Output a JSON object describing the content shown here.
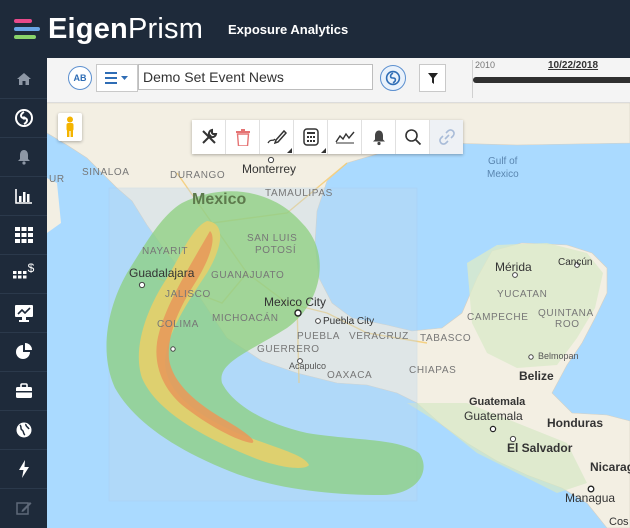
{
  "header": {
    "brand_part1": "Eigen",
    "brand_part2": "Prism",
    "app_title": "Exposure Analytics",
    "brand_colors": [
      "#e84a8a",
      "#6aa6e6",
      "#8ad46a"
    ]
  },
  "sidebar": {
    "items": [
      {
        "icon": "home-icon"
      },
      {
        "icon": "hurricane-icon"
      },
      {
        "icon": "bell-icon"
      },
      {
        "icon": "bar-chart-icon"
      },
      {
        "icon": "grid-icon"
      },
      {
        "icon": "grid-dollar-icon",
        "text": "$"
      },
      {
        "icon": "monitor-chart-icon"
      },
      {
        "icon": "pie-chart-icon"
      },
      {
        "icon": "briefcase-icon"
      },
      {
        "icon": "globe-icon"
      },
      {
        "icon": "lightning-icon"
      },
      {
        "icon": "edit-icon"
      }
    ]
  },
  "toolbar": {
    "ab_label": "AB",
    "event_value": "Demo Set Event News",
    "timeline_year": "2010",
    "timeline_date": "10/22/2018"
  },
  "map_tools": {
    "items": [
      "tools-icon",
      "trash-icon",
      "draw-icon",
      "calculator-icon",
      "chart-line-icon",
      "bell-icon",
      "search-icon",
      "link-icon"
    ]
  },
  "map_labels": {
    "mexico": "Mexico",
    "monterrey": "Monterrey",
    "tamaulipas": "TAMAULIPAS",
    "durango": "DURANGO",
    "sinaloa": "SINALOA",
    "ur": "UR",
    "nayarit": "NAYARIT",
    "san_luis": "SAN LUIS",
    "potosi": "POTOSÍ",
    "guadalajara": "Guadalajara",
    "guanajuato": "GUANAJUATO",
    "jalisco": "JALISCO",
    "mexico_city": "Mexico City",
    "colima": "COLIMA",
    "michoacan": "MICHOACÁN",
    "puebla_city": "Puebla City",
    "puebla": "PUEBLA",
    "veracruz": "VERACRUZ",
    "guerrero": "GUERRERO",
    "acapulco": "Acapulco",
    "oaxaca": "OAXACA",
    "tabasco": "TABASCO",
    "chiapas": "CHIAPAS",
    "campeche": "CAMPECHE",
    "quintana": "QUINTANA",
    "roo": "ROO",
    "yucatan": "YUCATAN",
    "merida": "Mérida",
    "cancun": "Cancún",
    "gulf1": "Gulf of",
    "gulf2": "Mexico",
    "belmopan": "Belmopan",
    "belize": "Belize",
    "guatemala1": "Guatemala",
    "guatemala2": "Guatemala",
    "honduras": "Honduras",
    "el_salvador": "El Salvador",
    "nicaragua": "Nicarag",
    "managua": "Managua",
    "cos": "Cos"
  },
  "colors": {
    "water": "#aadaff",
    "land": "#f4f1e6",
    "swath_green": "#8ccf7e",
    "swath_yellow": "#e6cf6a",
    "swath_orange": "#e79a5b",
    "selection": "#bcd8f0"
  }
}
